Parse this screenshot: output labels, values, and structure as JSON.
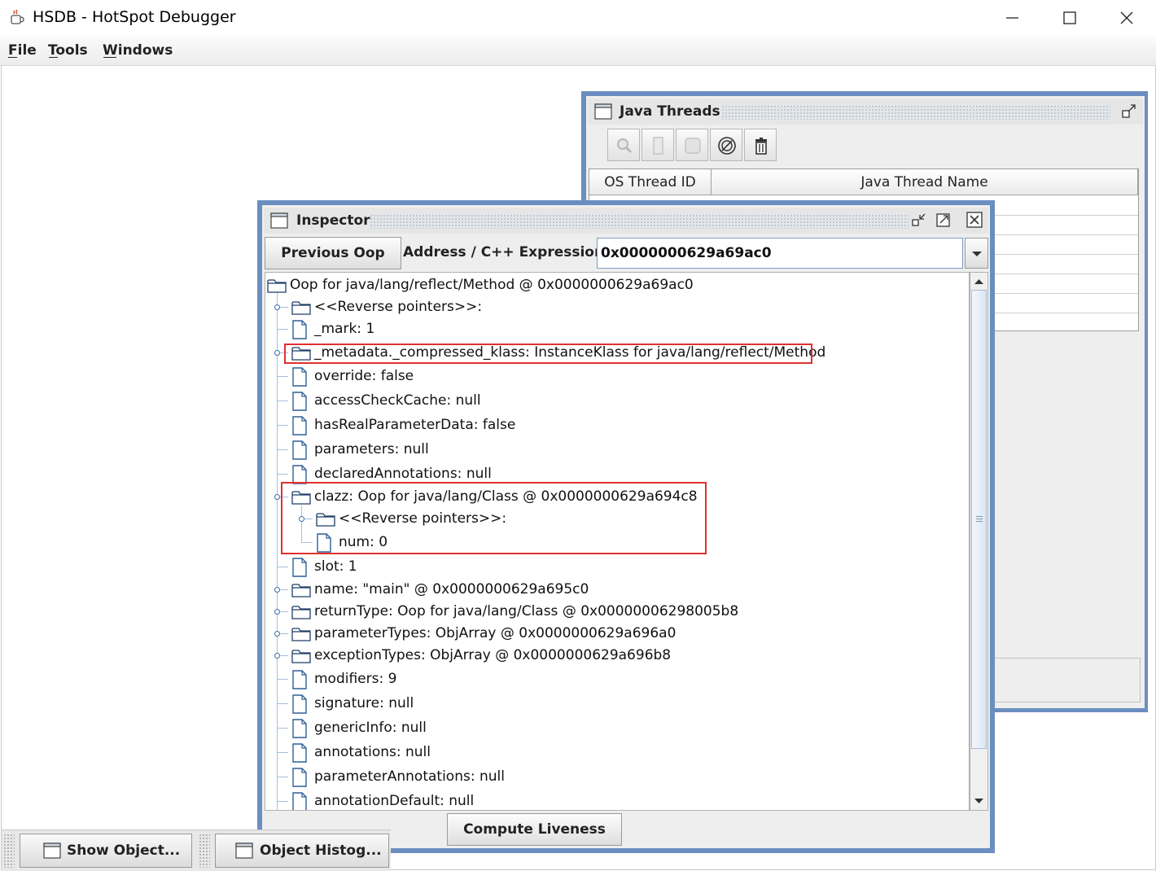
{
  "window": {
    "title": "HSDB - HotSpot Debugger"
  },
  "menubar": {
    "file": "File",
    "tools": "Tools",
    "windows": "Windows"
  },
  "java_threads": {
    "title": "Java Threads",
    "columns": [
      "OS Thread ID",
      "Java Thread Name"
    ],
    "toolbar_icons": [
      "inspect-icon",
      "stack-icon",
      "info-icon",
      "deadlock-icon",
      "delete-icon"
    ]
  },
  "inspector": {
    "title": "Inspector",
    "previous_oop": "Previous Oop",
    "address_label": "Address / C++ Expression:",
    "address_value": "0x0000000629a69ac0",
    "compute_liveness": "Compute Liveness",
    "tree": [
      {
        "label": "Oop for java/lang/reflect/Method @ 0x0000000629a69ac0",
        "type": "folder",
        "depth": 0,
        "handle": false
      },
      {
        "label": "<<Reverse pointers>>:",
        "type": "folder",
        "depth": 1,
        "handle": true
      },
      {
        "label": "_mark: 1",
        "type": "file",
        "depth": 1,
        "handle": false
      },
      {
        "label": "_metadata._compressed_klass: InstanceKlass for java/lang/reflect/Method",
        "type": "folder",
        "depth": 1,
        "handle": true
      },
      {
        "label": "override: false",
        "type": "file",
        "depth": 1,
        "handle": false
      },
      {
        "label": "accessCheckCache: null",
        "type": "file",
        "depth": 1,
        "handle": false
      },
      {
        "label": "hasRealParameterData: false",
        "type": "file",
        "depth": 1,
        "handle": false
      },
      {
        "label": "parameters: null",
        "type": "file",
        "depth": 1,
        "handle": false
      },
      {
        "label": "declaredAnnotations: null",
        "type": "file",
        "depth": 1,
        "handle": false
      },
      {
        "label": "clazz: Oop for java/lang/Class @ 0x0000000629a694c8",
        "type": "folder",
        "depth": 1,
        "handle": true,
        "expanded": true
      },
      {
        "label": "<<Reverse pointers>>:",
        "type": "folder",
        "depth": 2,
        "handle": true
      },
      {
        "label": "num: 0",
        "type": "file",
        "depth": 2,
        "handle": false
      },
      {
        "label": "slot: 1",
        "type": "file",
        "depth": 1,
        "handle": false
      },
      {
        "label": "name: \"main\" @ 0x0000000629a695c0",
        "type": "folder",
        "depth": 1,
        "handle": true
      },
      {
        "label": "returnType: Oop for java/lang/Class @ 0x00000006298005b8",
        "type": "folder",
        "depth": 1,
        "handle": true
      },
      {
        "label": "parameterTypes: ObjArray @ 0x0000000629a696a0",
        "type": "folder",
        "depth": 1,
        "handle": true
      },
      {
        "label": "exceptionTypes: ObjArray @ 0x0000000629a696b8",
        "type": "folder",
        "depth": 1,
        "handle": true
      },
      {
        "label": "modifiers: 9",
        "type": "file",
        "depth": 1,
        "handle": false
      },
      {
        "label": "signature: null",
        "type": "file",
        "depth": 1,
        "handle": false
      },
      {
        "label": "genericInfo: null",
        "type": "file",
        "depth": 1,
        "handle": false
      },
      {
        "label": "annotations: null",
        "type": "file",
        "depth": 1,
        "handle": false
      },
      {
        "label": "parameterAnnotations: null",
        "type": "file",
        "depth": 1,
        "handle": false
      },
      {
        "label": "annotationDefault: null",
        "type": "file",
        "depth": 1,
        "handle": false
      }
    ]
  },
  "minimized": {
    "show_object": "Show Object...",
    "object_histogram": "Object Histog..."
  },
  "colors": {
    "frame_border": "#6a8ebf",
    "highlight": "#e03030",
    "tree_line": "#a8c0dc",
    "icon_blue": "#2f5f96"
  }
}
